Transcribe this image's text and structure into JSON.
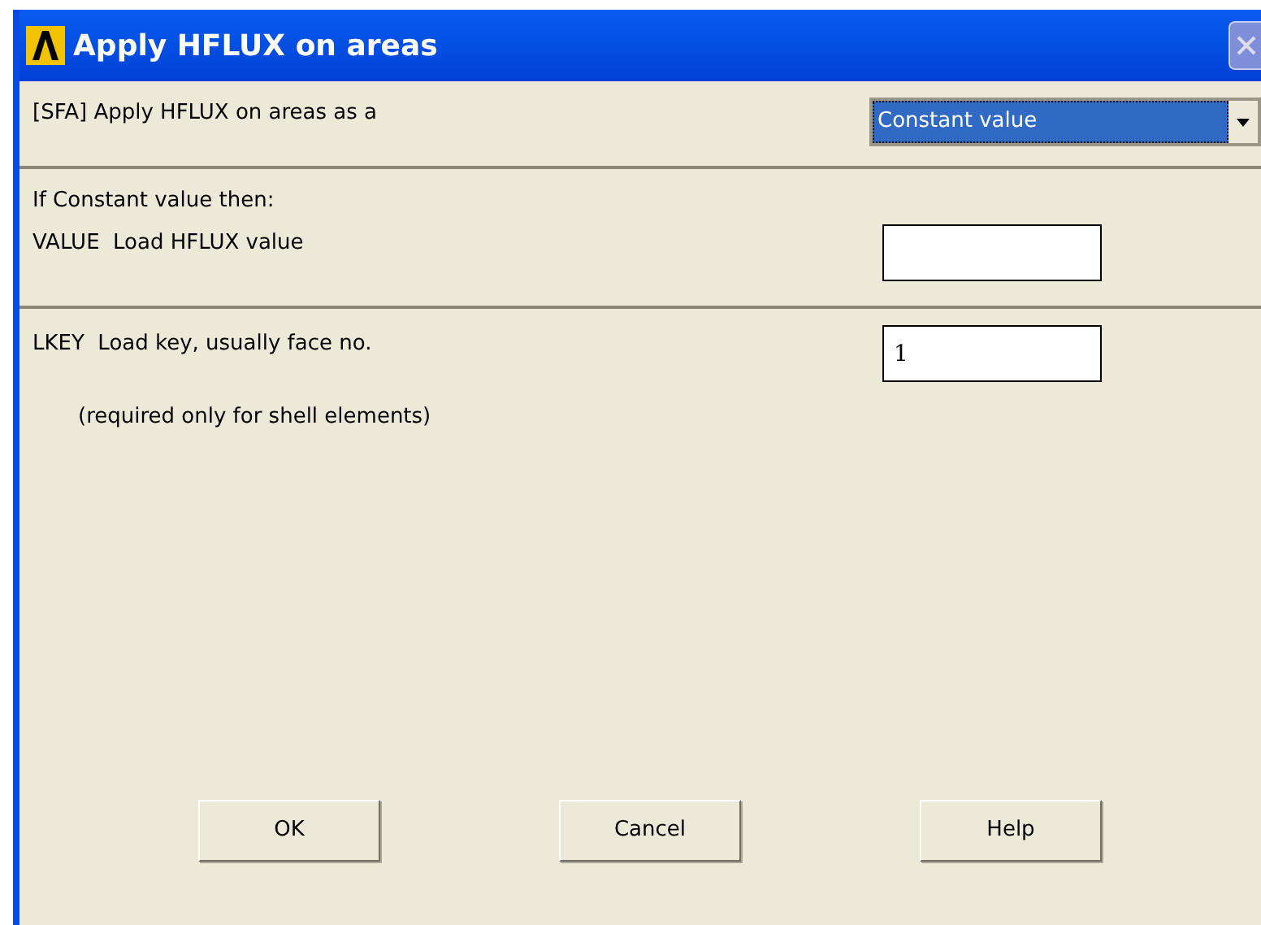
{
  "window": {
    "title": "Apply HFLUX on areas"
  },
  "sfa": {
    "label": "[SFA] Apply HFLUX on areas as a",
    "value": "Constant value"
  },
  "section_label": "If Constant value then:",
  "fields": [
    {
      "label": "VALUE  Load HFLUX value"
    },
    {
      "label": "LKEY  Load key, usually face no.",
      "value": "1",
      "note": "(required only for shell elements)"
    }
  ],
  "buttons": [
    "OK",
    "Cancel",
    "Help"
  ]
}
